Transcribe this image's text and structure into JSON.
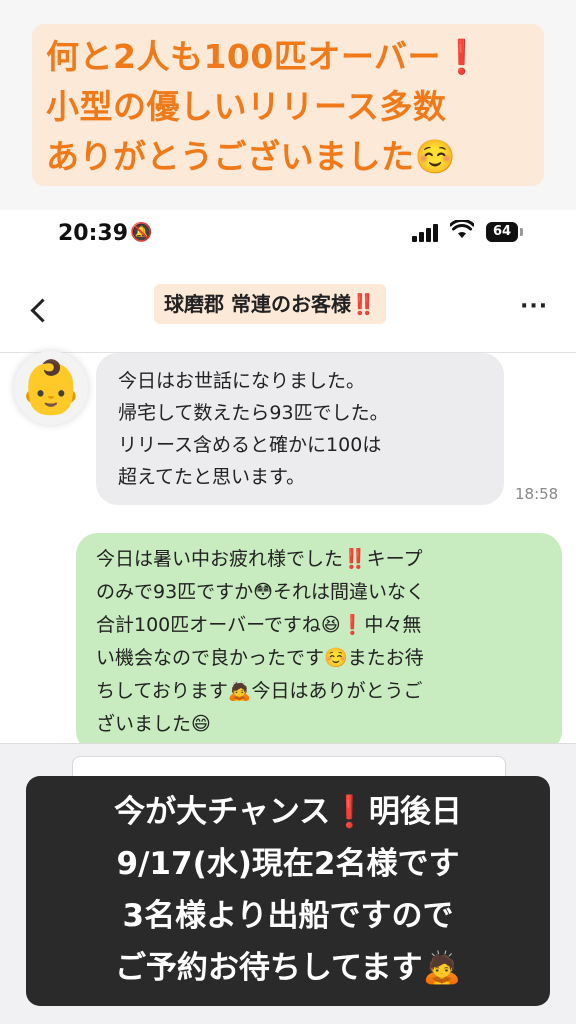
{
  "top_banner": {
    "lines": [
      "何と2人も100匹オーバー❗",
      "小型の優しいリリース多数",
      "ありがとうございました☺️"
    ]
  },
  "status_bar": {
    "time": "20:39",
    "mute_icon": "🔕",
    "battery": "64"
  },
  "header": {
    "title": "球磨郡 常連のお客様‼️",
    "more": "···"
  },
  "messages": [
    {
      "direction": "incoming",
      "avatar": "👶",
      "lines": [
        "今日はお世話になりました。",
        "帰宅して数えたら93匹でした。",
        "リリース含めると確かに100は",
        "超えてたと思います。"
      ],
      "timestamp": "18:58"
    },
    {
      "direction": "outgoing",
      "lines": [
        "今日は暑い中お疲れ様でした‼️キープ",
        "のみで93匹ですか😳それは間違いなく",
        "合計100匹オーバーですね😆❗中々無",
        "い機会なので良かったです☺️またお待",
        "ちしております🙇今日はありがとうご",
        "ざいました😄"
      ]
    }
  ],
  "bottom_banner": {
    "lines": [
      "今が大チャンス❗明後日",
      "9/17(水)現在2名様です",
      "3名様より出船ですので",
      "ご予約お待ちしてます🙇"
    ]
  },
  "colors": {
    "accent_orange": "#f07a1a",
    "banner_bg": "#fde9d8",
    "outgoing_bubble": "#c8ecc0",
    "incoming_bubble": "#ececef",
    "bottom_banner_bg": "#2a2a2a"
  }
}
